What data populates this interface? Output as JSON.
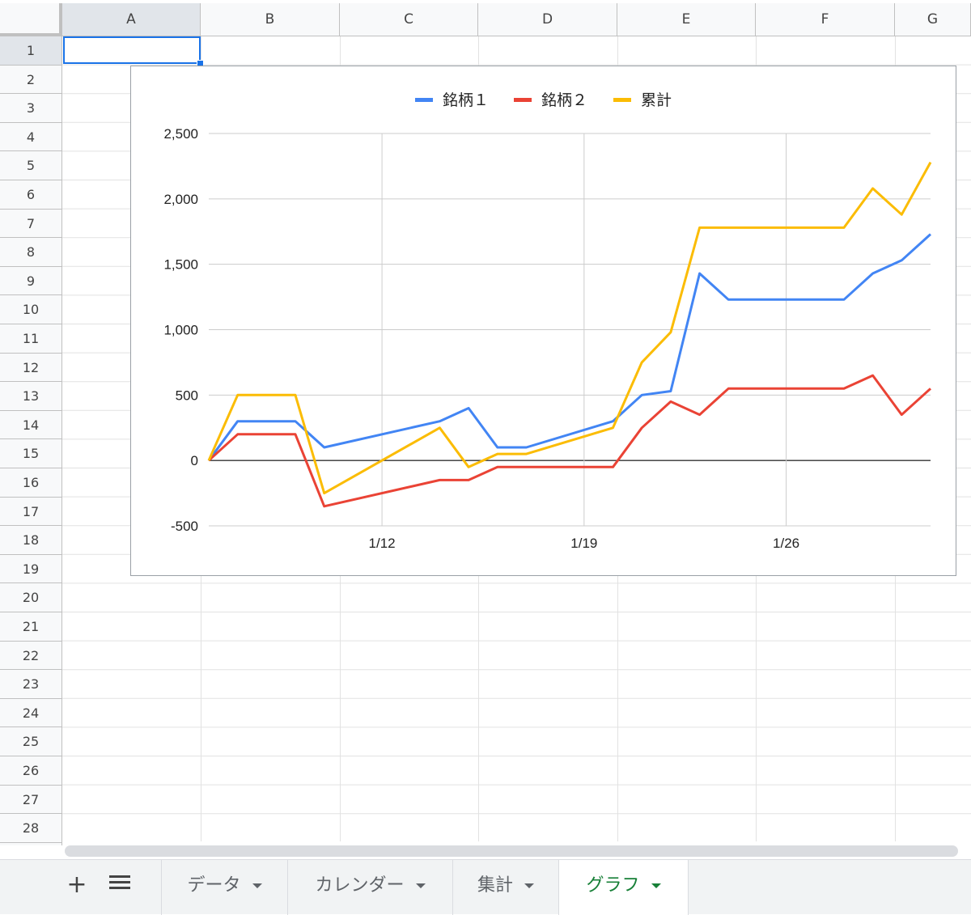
{
  "spreadsheet": {
    "columns": [
      "A",
      "B",
      "C",
      "D",
      "E",
      "F",
      "G"
    ],
    "rows": [
      "1",
      "2",
      "3",
      "4",
      "5",
      "6",
      "7",
      "8",
      "9",
      "10",
      "11",
      "12",
      "13",
      "14",
      "15",
      "16",
      "17",
      "18",
      "19",
      "20",
      "21",
      "22",
      "23",
      "24",
      "25",
      "26",
      "27",
      "28"
    ],
    "selected_cell": "A1"
  },
  "sheet_tabs": [
    {
      "label": "データ"
    },
    {
      "label": "カレンダー"
    },
    {
      "label": "集計"
    },
    {
      "label": "グラフ",
      "active": true
    }
  ],
  "toolbar": {
    "add_sheet_label": "+"
  },
  "colors": {
    "series1": "#4285f4",
    "series2": "#ea4335",
    "series3": "#fbbc04",
    "active_tab": "#188038",
    "selection": "#1a73e8"
  },
  "chart_data": {
    "type": "line",
    "title": "",
    "xlabel": "",
    "ylabel": "",
    "legend_position": "top",
    "x_tick_labels": [
      "1/12",
      "1/19",
      "1/26"
    ],
    "x_tick_days": [
      12,
      19,
      26
    ],
    "y_tick_labels": [
      "2,500",
      "2,000",
      "1,500",
      "1,000",
      "500",
      "0",
      "-500"
    ],
    "y_tick_values": [
      2500,
      2000,
      1500,
      1000,
      500,
      0,
      -500
    ],
    "ylim": [
      -500,
      2500
    ],
    "xlim": [
      6,
      31
    ],
    "x": [
      6,
      7,
      9,
      10,
      14,
      15,
      16,
      17,
      20,
      21,
      22,
      23,
      24,
      28,
      29,
      30,
      31
    ],
    "series": [
      {
        "name": "銘柄１",
        "color": "#4285f4",
        "values": [
          0,
          300,
          300,
          100,
          300,
          400,
          100,
          100,
          300,
          500,
          530,
          1430,
          1230,
          1230,
          1430,
          1530,
          1730
        ]
      },
      {
        "name": "銘柄２",
        "color": "#ea4335",
        "values": [
          0,
          200,
          200,
          -350,
          -150,
          -150,
          -50,
          -50,
          -50,
          250,
          450,
          350,
          550,
          550,
          650,
          350,
          550
        ]
      },
      {
        "name": "累計",
        "color": "#fbbc04",
        "values": [
          0,
          500,
          500,
          -250,
          250,
          -50,
          50,
          50,
          250,
          750,
          980,
          1780,
          1780,
          1780,
          2080,
          1880,
          2280
        ]
      }
    ]
  }
}
